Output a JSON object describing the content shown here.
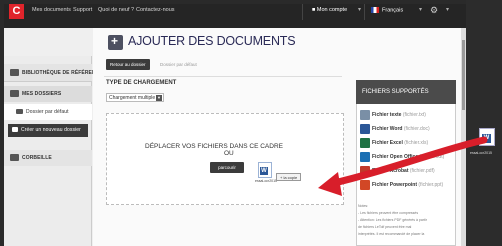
{
  "topbar": {
    "logo": "C",
    "links": [
      "Mes documents",
      "Support",
      "Quoi de neuf ?",
      "Contactez-nous"
    ],
    "account": "Mon compte",
    "language": "Français"
  },
  "sidebar": {
    "reference": "BIBLIOTHÈQUE DE RÉFÉRENCE",
    "folders": "MES DOSSIERS",
    "default_folder": "Dossier par défaut",
    "create_folder": "Créer un nouveau dossier",
    "trash": "CORBEILLE"
  },
  "page": {
    "title": "AJOUTER DES DOCUMENTS",
    "back_button": "Retour au dossier",
    "default_folder_link": "Dossier par défaut",
    "type_label": "TYPE DE CHARGEMENT",
    "type_value": "Chargement multiple",
    "drop_line1": "DÉPLACER VOS FICHIERS DANS CE CADRE",
    "drop_line2": "OU",
    "browse_button": "parcourir",
    "drag_filename": "essai-ocr2015",
    "copy_tip": "+ la copie"
  },
  "panel": {
    "title": "FICHIERS SUPPORTÉS",
    "types": [
      {
        "name": "Fichier texte",
        "ext": "(fichier.txt)",
        "color": "#7a8fa6"
      },
      {
        "name": "Fichier Word",
        "ext": "(fichier.doc)",
        "color": "#2b5797"
      },
      {
        "name": "Fichier Excel",
        "ext": "(fichier.xls)",
        "color": "#1f7244"
      },
      {
        "name": "Fichier Open Office",
        "ext": "(fichier.odt)",
        "color": "#1b6fb3"
      },
      {
        "name": "Fichier Acrobat",
        "ext": "(fichier.pdf)",
        "color": "#c0392b"
      },
      {
        "name": "Fichier Powerpoint",
        "ext": "(fichier.ppt)",
        "color": "#d24726"
      }
    ],
    "notes": [
      "Notes:",
      "- Les fichiers peuvent être compressés",
      "- Attention: Les fichiers PDF générés à partir",
      "de fichiers LeTolf peuvent être mal",
      "interprétés. Il est recommandé de placer la"
    ]
  },
  "desktop": {
    "filename": "essai-ocr2015"
  },
  "colors": {
    "accent": "#e0242b",
    "arrow": "#d81e2a",
    "dark": "#3b3b3b"
  }
}
